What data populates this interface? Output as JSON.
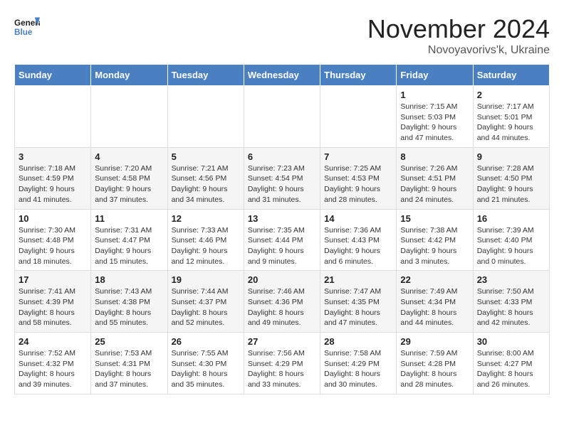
{
  "header": {
    "logo_line1": "General",
    "logo_line2": "Blue",
    "month": "November 2024",
    "location": "Novoyavorivs'k, Ukraine"
  },
  "days_of_week": [
    "Sunday",
    "Monday",
    "Tuesday",
    "Wednesday",
    "Thursday",
    "Friday",
    "Saturday"
  ],
  "weeks": [
    [
      {
        "day": "",
        "info": ""
      },
      {
        "day": "",
        "info": ""
      },
      {
        "day": "",
        "info": ""
      },
      {
        "day": "",
        "info": ""
      },
      {
        "day": "",
        "info": ""
      },
      {
        "day": "1",
        "info": "Sunrise: 7:15 AM\nSunset: 5:03 PM\nDaylight: 9 hours and 47 minutes."
      },
      {
        "day": "2",
        "info": "Sunrise: 7:17 AM\nSunset: 5:01 PM\nDaylight: 9 hours and 44 minutes."
      }
    ],
    [
      {
        "day": "3",
        "info": "Sunrise: 7:18 AM\nSunset: 4:59 PM\nDaylight: 9 hours and 41 minutes."
      },
      {
        "day": "4",
        "info": "Sunrise: 7:20 AM\nSunset: 4:58 PM\nDaylight: 9 hours and 37 minutes."
      },
      {
        "day": "5",
        "info": "Sunrise: 7:21 AM\nSunset: 4:56 PM\nDaylight: 9 hours and 34 minutes."
      },
      {
        "day": "6",
        "info": "Sunrise: 7:23 AM\nSunset: 4:54 PM\nDaylight: 9 hours and 31 minutes."
      },
      {
        "day": "7",
        "info": "Sunrise: 7:25 AM\nSunset: 4:53 PM\nDaylight: 9 hours and 28 minutes."
      },
      {
        "day": "8",
        "info": "Sunrise: 7:26 AM\nSunset: 4:51 PM\nDaylight: 9 hours and 24 minutes."
      },
      {
        "day": "9",
        "info": "Sunrise: 7:28 AM\nSunset: 4:50 PM\nDaylight: 9 hours and 21 minutes."
      }
    ],
    [
      {
        "day": "10",
        "info": "Sunrise: 7:30 AM\nSunset: 4:48 PM\nDaylight: 9 hours and 18 minutes."
      },
      {
        "day": "11",
        "info": "Sunrise: 7:31 AM\nSunset: 4:47 PM\nDaylight: 9 hours and 15 minutes."
      },
      {
        "day": "12",
        "info": "Sunrise: 7:33 AM\nSunset: 4:46 PM\nDaylight: 9 hours and 12 minutes."
      },
      {
        "day": "13",
        "info": "Sunrise: 7:35 AM\nSunset: 4:44 PM\nDaylight: 9 hours and 9 minutes."
      },
      {
        "day": "14",
        "info": "Sunrise: 7:36 AM\nSunset: 4:43 PM\nDaylight: 9 hours and 6 minutes."
      },
      {
        "day": "15",
        "info": "Sunrise: 7:38 AM\nSunset: 4:42 PM\nDaylight: 9 hours and 3 minutes."
      },
      {
        "day": "16",
        "info": "Sunrise: 7:39 AM\nSunset: 4:40 PM\nDaylight: 9 hours and 0 minutes."
      }
    ],
    [
      {
        "day": "17",
        "info": "Sunrise: 7:41 AM\nSunset: 4:39 PM\nDaylight: 8 hours and 58 minutes."
      },
      {
        "day": "18",
        "info": "Sunrise: 7:43 AM\nSunset: 4:38 PM\nDaylight: 8 hours and 55 minutes."
      },
      {
        "day": "19",
        "info": "Sunrise: 7:44 AM\nSunset: 4:37 PM\nDaylight: 8 hours and 52 minutes."
      },
      {
        "day": "20",
        "info": "Sunrise: 7:46 AM\nSunset: 4:36 PM\nDaylight: 8 hours and 49 minutes."
      },
      {
        "day": "21",
        "info": "Sunrise: 7:47 AM\nSunset: 4:35 PM\nDaylight: 8 hours and 47 minutes."
      },
      {
        "day": "22",
        "info": "Sunrise: 7:49 AM\nSunset: 4:34 PM\nDaylight: 8 hours and 44 minutes."
      },
      {
        "day": "23",
        "info": "Sunrise: 7:50 AM\nSunset: 4:33 PM\nDaylight: 8 hours and 42 minutes."
      }
    ],
    [
      {
        "day": "24",
        "info": "Sunrise: 7:52 AM\nSunset: 4:32 PM\nDaylight: 8 hours and 39 minutes."
      },
      {
        "day": "25",
        "info": "Sunrise: 7:53 AM\nSunset: 4:31 PM\nDaylight: 8 hours and 37 minutes."
      },
      {
        "day": "26",
        "info": "Sunrise: 7:55 AM\nSunset: 4:30 PM\nDaylight: 8 hours and 35 minutes."
      },
      {
        "day": "27",
        "info": "Sunrise: 7:56 AM\nSunset: 4:29 PM\nDaylight: 8 hours and 33 minutes."
      },
      {
        "day": "28",
        "info": "Sunrise: 7:58 AM\nSunset: 4:29 PM\nDaylight: 8 hours and 30 minutes."
      },
      {
        "day": "29",
        "info": "Sunrise: 7:59 AM\nSunset: 4:28 PM\nDaylight: 8 hours and 28 minutes."
      },
      {
        "day": "30",
        "info": "Sunrise: 8:00 AM\nSunset: 4:27 PM\nDaylight: 8 hours and 26 minutes."
      }
    ]
  ]
}
